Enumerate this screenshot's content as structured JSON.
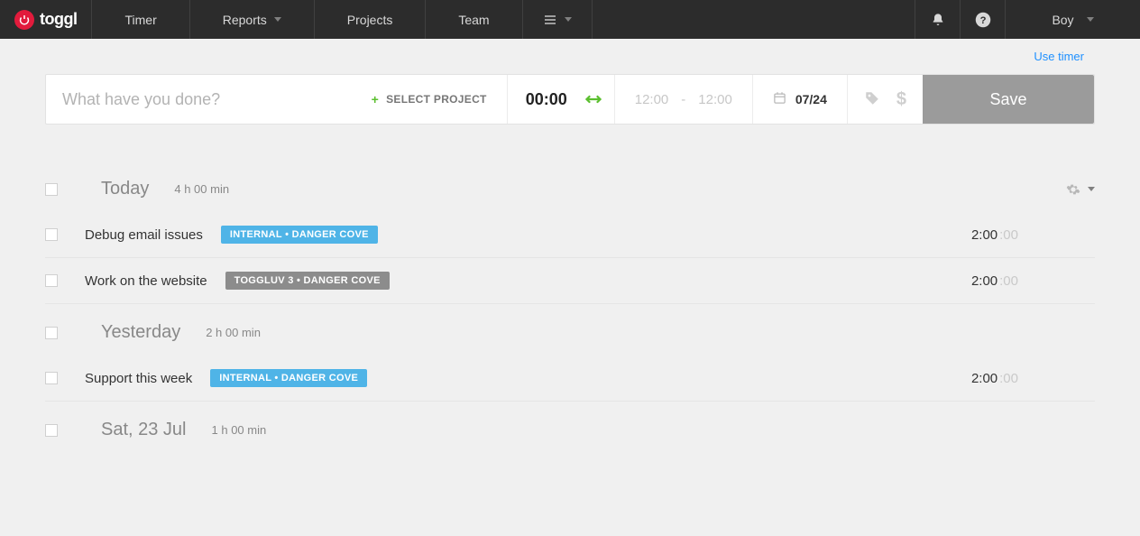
{
  "nav": {
    "logo_text": "toggl",
    "items": [
      "Timer",
      "Reports",
      "Projects",
      "Team"
    ],
    "user": "Boy"
  },
  "top_link": "Use timer",
  "timer": {
    "placeholder": "What have you done?",
    "select_project": "SELECT PROJECT",
    "duration": "00:00",
    "start": "12:00",
    "sep": "-",
    "end": "12:00",
    "date": "07/24",
    "save": "Save"
  },
  "days": [
    {
      "title": "Today",
      "total": "4 h 00 min",
      "show_gear": true,
      "entries": [
        {
          "desc": "Debug email issues",
          "tag": "INTERNAL  •  DANGER COVE",
          "tag_color": "blue",
          "dur": "2:00",
          "sec": "00"
        },
        {
          "desc": "Work on the website",
          "tag": "TOGGLUV 3  •  DANGER COVE",
          "tag_color": "gray",
          "dur": "2:00",
          "sec": "00"
        }
      ]
    },
    {
      "title": "Yesterday",
      "total": "2 h 00 min",
      "show_gear": false,
      "entries": [
        {
          "desc": "Support this week",
          "tag": "INTERNAL  •  DANGER COVE",
          "tag_color": "blue",
          "dur": "2:00",
          "sec": "00"
        }
      ]
    },
    {
      "title": "Sat, 23 Jul",
      "total": "1 h 00 min",
      "show_gear": false,
      "entries": []
    }
  ]
}
